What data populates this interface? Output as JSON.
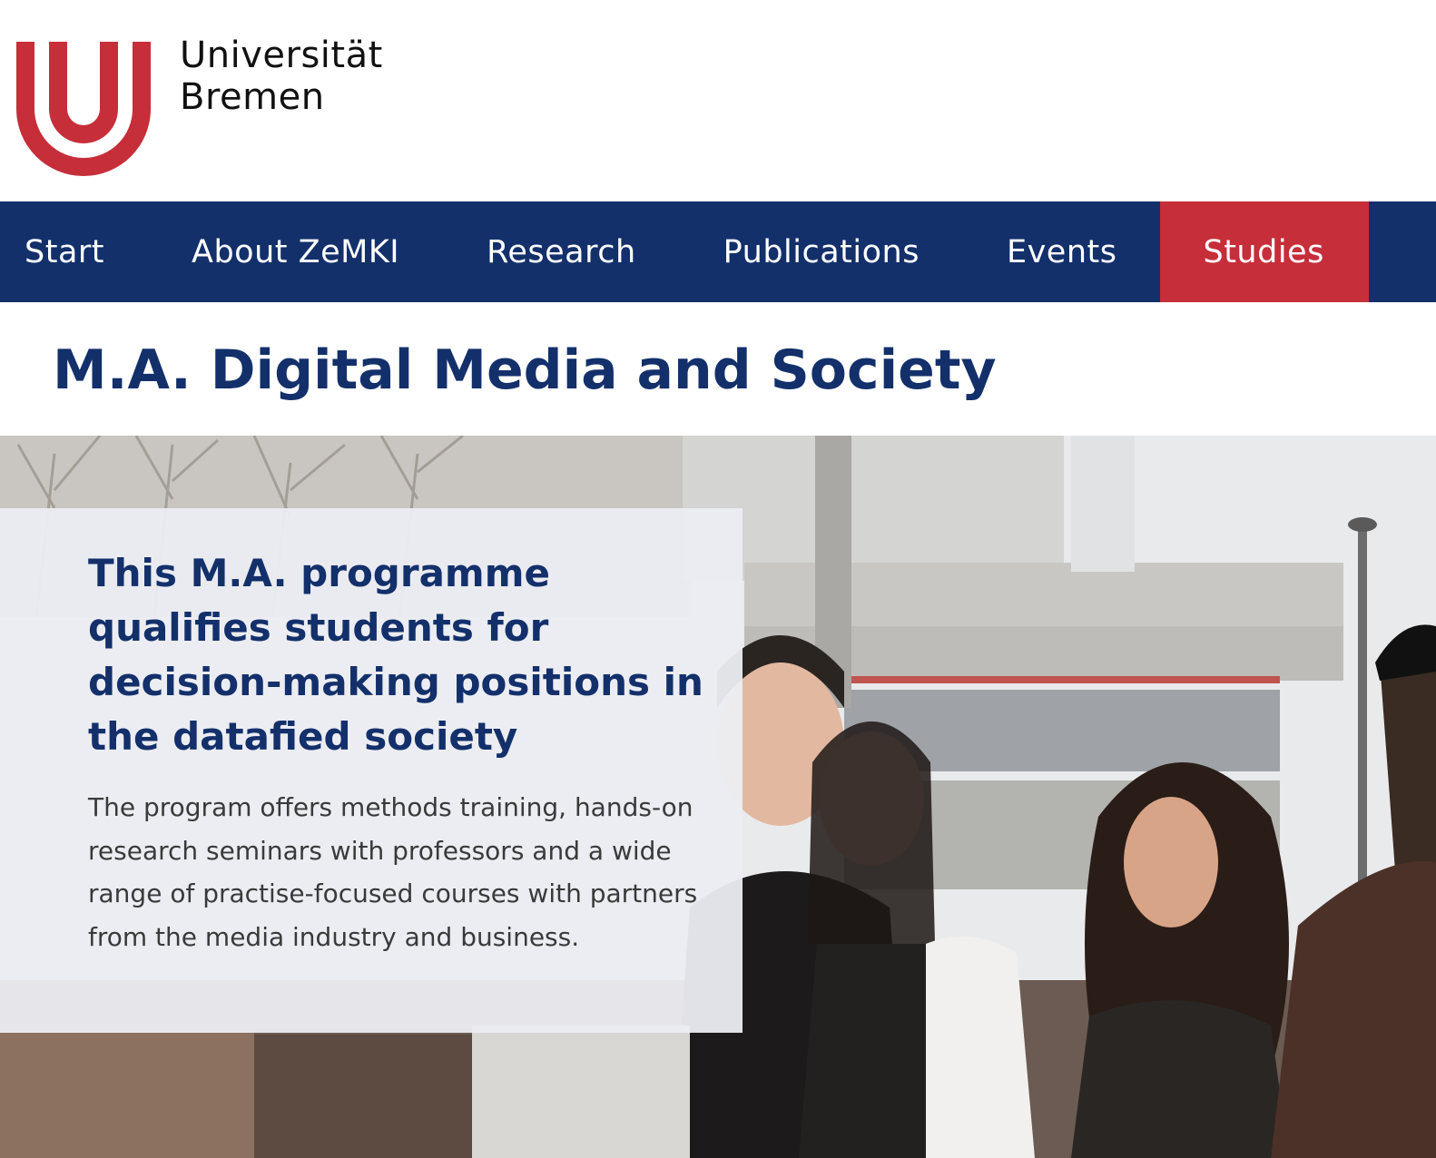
{
  "branding": {
    "logo_line1": "Universität",
    "logo_line2": "Bremen",
    "logo_color": "#c62e3a"
  },
  "nav": {
    "items": [
      {
        "label": "Start"
      },
      {
        "label": "About ZeMKI"
      },
      {
        "label": "Research"
      },
      {
        "label": "Publications"
      },
      {
        "label": "Events"
      },
      {
        "label": "Studies",
        "active": true
      }
    ],
    "background_color": "#13306b",
    "active_color": "#c62e3a"
  },
  "page": {
    "title": "M.A. Digital Media and Society"
  },
  "hero": {
    "heading": "This M.A. programme qualifies students for decision-making positions in the datafied society",
    "body": "The program offers methods training, hands-on research seminars with professors and a wide range of practise-focused courses with partners from the media industry and business.",
    "image_description": "students-on-campus-photo"
  }
}
